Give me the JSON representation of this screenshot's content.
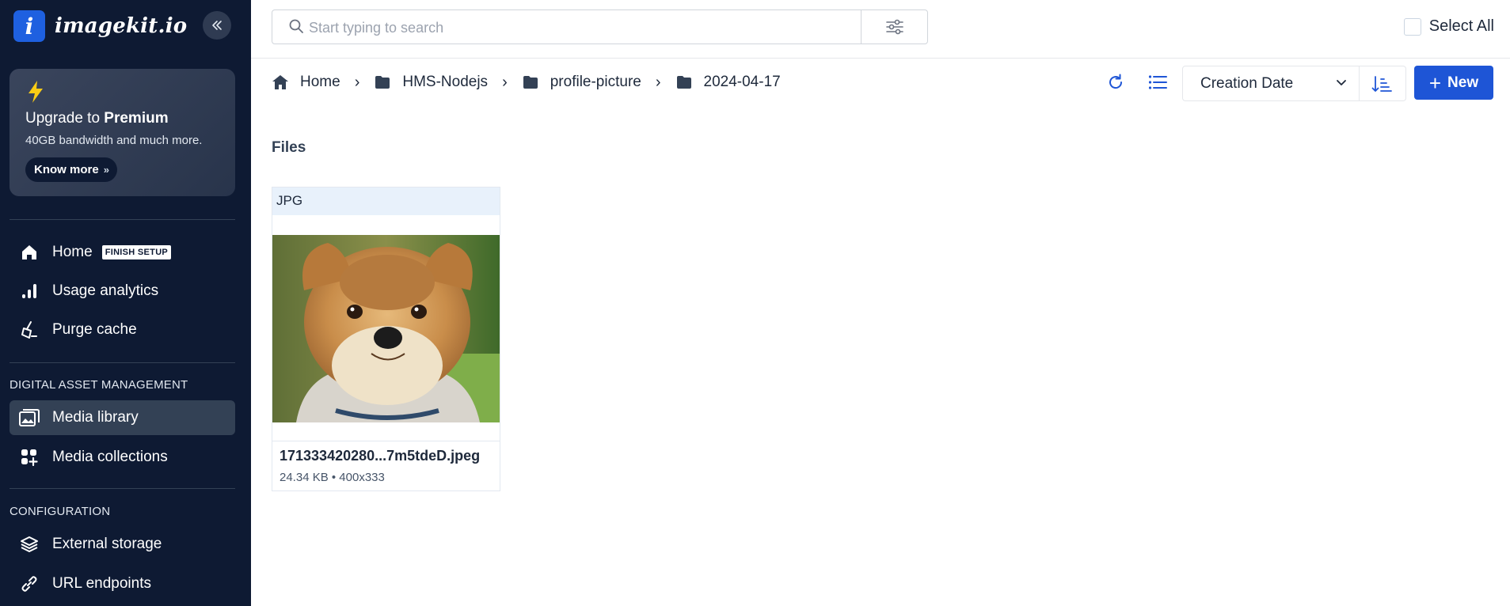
{
  "brand": {
    "logo_letter": "i",
    "name": "imagekit.io"
  },
  "promo": {
    "title_prefix": "Upgrade to ",
    "title_bold": "Premium",
    "subtitle": "40GB bandwidth and much more.",
    "button": "Know more",
    "button_chevron": "»"
  },
  "nav": {
    "home": {
      "label": "Home",
      "badge": "FINISH SETUP"
    },
    "usage": {
      "label": "Usage analytics"
    },
    "purge": {
      "label": "Purge cache"
    },
    "section_dam": "DIGITAL ASSET MANAGEMENT",
    "media_library": {
      "label": "Media library"
    },
    "media_collections": {
      "label": "Media collections"
    },
    "section_config": "CONFIGURATION",
    "external_storage": {
      "label": "External storage"
    },
    "url_endpoints": {
      "label": "URL endpoints"
    }
  },
  "search": {
    "placeholder": "Start typing to search",
    "value": ""
  },
  "select_all": {
    "label": "Select All",
    "checked": false
  },
  "breadcrumb": {
    "home": "Home",
    "items": [
      "HMS-Nodejs",
      "profile-picture",
      "2024-04-17"
    ],
    "separator": "›"
  },
  "toolbar": {
    "sort_by": "Creation Date",
    "new_label": "New",
    "new_plus": "+"
  },
  "files": {
    "heading": "Files",
    "items": [
      {
        "type": "JPG",
        "name": "171333420280...7m5tdeD.jpeg",
        "meta": "24.34 KB • 400x333"
      }
    ]
  },
  "colors": {
    "sidebar_bg": "#0e1a33",
    "accent": "#1e55d6",
    "promo_bolt": "#facc15"
  }
}
